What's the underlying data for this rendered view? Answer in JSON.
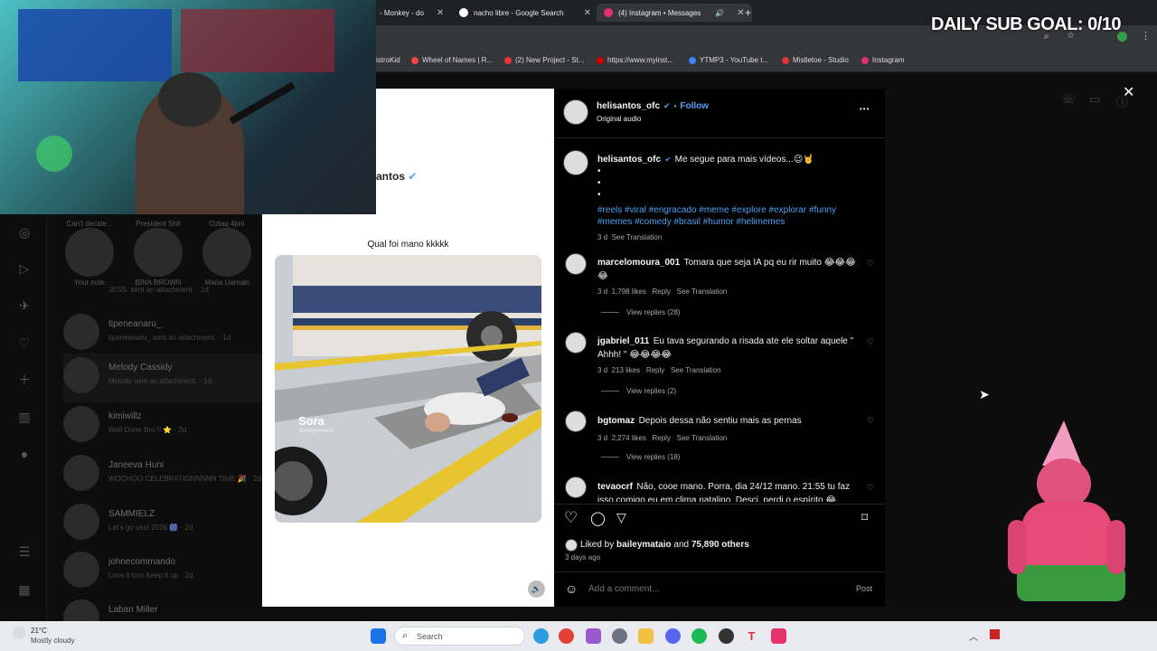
{
  "browser": {
    "tabs": [
      {
        "title": "- Monkey - do",
        "icon": "monkey-tab-icon",
        "color": "#e67e22"
      },
      {
        "title": "nacho libre - Google Search",
        "icon": "google-icon",
        "color": "#ffffff"
      },
      {
        "title": "(4) Instagram • Messages",
        "icon": "instagram-icon",
        "color": "#e1306c"
      }
    ],
    "new_tab": "+",
    "bookmarks": [
      {
        "label": "istroKid",
        "icon": "distrokid-icon",
        "color": "#888888"
      },
      {
        "label": "Wheel of Names | R...",
        "icon": "wheel-icon",
        "color": "#e44"
      },
      {
        "label": "(2) New Project - St...",
        "icon": "project-icon",
        "color": "#e33"
      },
      {
        "label": "https://www.myinst...",
        "icon": "myinst-icon",
        "color": "#c00"
      },
      {
        "label": "YTMP3 - YouTube t...",
        "icon": "ytmp3-icon",
        "color": "#3b82f6"
      },
      {
        "label": "Mistletoe - Studio",
        "icon": "mistletoe-icon",
        "color": "#d33"
      },
      {
        "label": "Instagram",
        "icon": "instagram-icon",
        "color": "#e1306c"
      }
    ]
  },
  "overlay": {
    "goal_text": "DAILY SUB GOAL: 0/10"
  },
  "background": {
    "partial_username": "antos",
    "notes": [
      {
        "top": "Can't decide...",
        "label": "Your note"
      },
      {
        "top": "President Shit",
        "label": "BINA BROWN"
      },
      {
        "top": "Oztaq 4pm",
        "label": "Maria Uamaki"
      }
    ],
    "jess_line": "JESS. sent an attachment. · 1d",
    "chats": [
      {
        "name": "tipeneanaru_",
        "sub": "tipeneanaru_ sent an attachment. · 1d"
      },
      {
        "name": "Melody Cassidy",
        "sub": "Melody sent an attachment. · 1d"
      },
      {
        "name": "kimiwillz",
        "sub": "Well Done Bro !! ⭐ · 2d"
      },
      {
        "name": "Janeeva Huni",
        "sub": "WOOHOO CELEBRATIONNNNN TIME 🎉 · 2d"
      },
      {
        "name": "SAMMIELZ",
        "sub": "Let's go uso! 2026 🎆 · 2d"
      },
      {
        "name": "johnecommando",
        "sub": "Love it broi Keep it up · 2d"
      },
      {
        "name": "Laban Miller",
        "sub": ""
      }
    ]
  },
  "post": {
    "video_caption": "Qual foi mano kkkkk",
    "watermark": "Sora",
    "watermark_handle": "@rickyberwick",
    "author": "helisantos_ofc",
    "follow": "Follow",
    "separator": "•",
    "audio": "Original audio",
    "more_icon": "•••",
    "caption_text": "Me segue para mais vídeos...😉🤘",
    "caption_dots": [
      "•",
      "•",
      "•"
    ],
    "hashtags": "#reels #viral #engracado #meme #explore #explorar #funny #memes #comedy #brasil #humor #helimemes",
    "caption_time": "3 d",
    "see_translation": "See Translation",
    "comments": [
      {
        "user": "marcelomoura_001",
        "text": "Tomara que seja IA pq eu rir muito 😂😂😂😂",
        "time": "3 d",
        "likes": "1,798 likes",
        "reply": "Reply",
        "translation": "See Translation",
        "view_replies": "View replies (28)"
      },
      {
        "user": "jgabriel_011",
        "text": "Eu tava segurando a risada ate ele soltar aquele \" Ahhh! \" 😂😂😂😂",
        "time": "3 d",
        "likes": "213 likes",
        "reply": "Reply",
        "translation": "See Translation",
        "view_replies": "View replies (2)"
      },
      {
        "user": "bgtomaz",
        "text": "Depois dessa não sentiu mais as pernas",
        "time": "3 d",
        "likes": "2,274 likes",
        "reply": "Reply",
        "translation": "See Translation",
        "view_replies": "View replies (18)"
      },
      {
        "user": "tevaocrf",
        "text": "Não, cooe mano. Porra, dia 24/12 mano. 21:55 tu faz isso comigo eu em clima natalino. Desci, perdi o espírito 😂",
        "time": "",
        "likes": "",
        "reply": "",
        "translation": "",
        "view_replies": ""
      }
    ],
    "liked_by_prefix": "Liked by",
    "liked_by_user": "baileymataio",
    "liked_by_and": "and",
    "liked_by_others": "75,890 others",
    "posted": "3 days ago",
    "comment_placeholder": "Add a comment...",
    "post_button": "Post"
  },
  "taskbar": {
    "weather_temp": "21°C",
    "weather_desc": "Mostly cloudy",
    "search_placeholder": "Search"
  }
}
